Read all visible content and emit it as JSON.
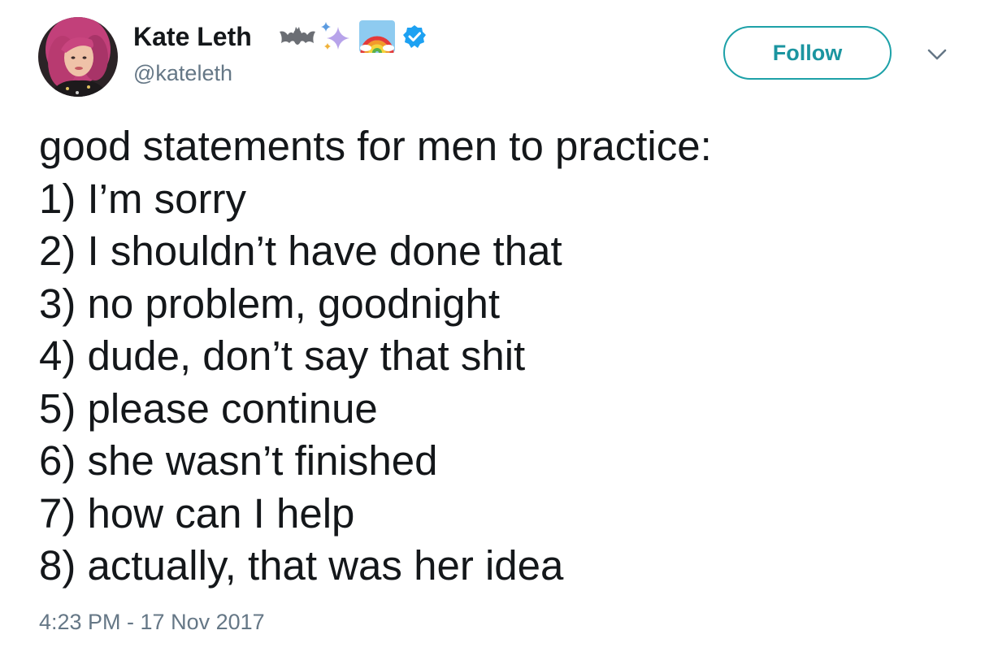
{
  "tweet": {
    "author": {
      "display_name": "Kate Leth",
      "handle": "@kateleth",
      "name_emojis": [
        "bat-emoji",
        "sparkles-emoji",
        "rainbow-emoji"
      ],
      "verified": true,
      "verified_color": "#1da1f2"
    },
    "follow_button": {
      "label": "Follow",
      "color": "#1b95a0"
    },
    "menu_icon": "chevron-down-icon",
    "text_lines": [
      "good statements for men to practice:",
      "1) I’m sorry",
      "2) I shouldn’t have done that",
      "3) no problem, goodnight",
      "4) dude, don’t say that shit",
      "5) please continue",
      "6) she wasn’t finished",
      "7) how can I help",
      "8) actually, that was her idea"
    ],
    "timestamp": "4:23 PM - 17 Nov 2017"
  }
}
